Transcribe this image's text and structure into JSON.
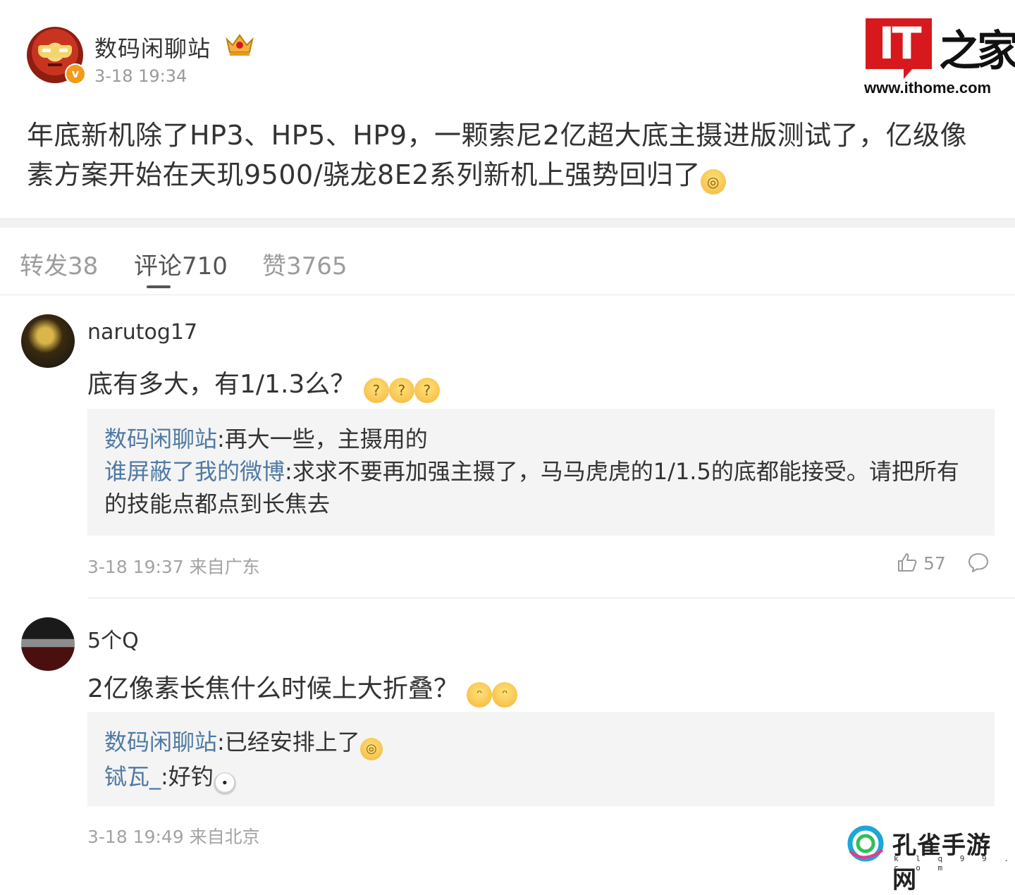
{
  "post": {
    "author": "数码闲聊站",
    "time": "3-18 19:34",
    "text": "年底新机除了HP3、HP5、HP9，一颗索尼2亿超大底主摄进版测试了，亿级像素方案开始在天玑9500/骁龙8E2系列新机上强势回归了",
    "verified_mark": "v"
  },
  "logo": {
    "it": "IT",
    "cn": "之家",
    "url": "www.ithome.com"
  },
  "tabs": [
    {
      "label": "转发38"
    },
    {
      "label": "评论710"
    },
    {
      "label": "赞3765"
    }
  ],
  "comments": [
    {
      "user": "narutog17",
      "text": "底有多大，有1/1.3么？",
      "replies": [
        {
          "user": "数码闲聊站",
          "text": ":再大一些，主摄用的"
        },
        {
          "user": "谁屏蔽了我的微博",
          "text": ":求求不要再加强主摄了，马马虎虎的1/1.5的底都能接受。请把所有的技能点都点到长焦去"
        }
      ],
      "meta": "3-18 19:37 来自广东",
      "likes": "57"
    },
    {
      "user": "5个Q",
      "text": "2亿像素长焦什么时候上大折叠？",
      "replies": [
        {
          "user": "数码闲聊站",
          "text": ":已经安排上了"
        },
        {
          "user": "铽瓦_",
          "text": ":好钓"
        }
      ],
      "meta": "3-18 19:49 来自北京"
    }
  ],
  "watermark": {
    "name": "孔雀手游网",
    "sub": "k l q 9 9 . c o m"
  },
  "colors": {
    "reply_user": "#4f7aa6",
    "it_red": "#d7191d",
    "muted": "#9c9c9c"
  }
}
